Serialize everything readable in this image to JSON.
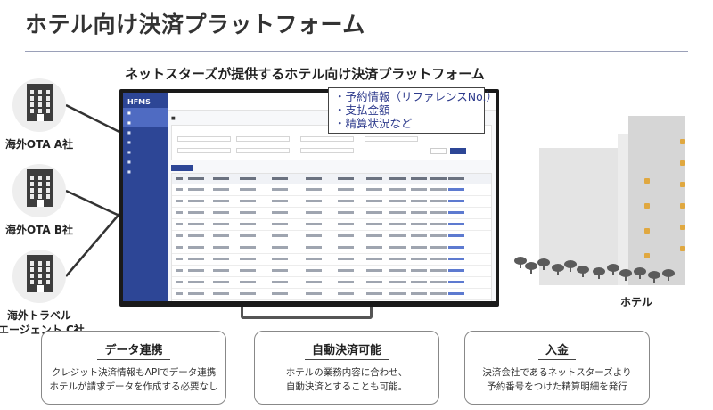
{
  "page_title": "ホテル向け決済プラットフォーム",
  "subtitle": "ネットスターズが提供するホテル向け決済プラットフォーム",
  "companies": [
    {
      "label_lines": [
        "海外OTA A社"
      ]
    },
    {
      "label_lines": [
        "海外OTA B社"
      ]
    },
    {
      "label_lines": [
        "海外トラベル",
        "エージェント C社"
      ]
    }
  ],
  "callout": {
    "items": [
      "・予約情報（リファレンスNo.）",
      "・支払金額",
      "・精算状況など"
    ]
  },
  "hotel_label": "ホテル",
  "features": [
    {
      "title": "データ連携",
      "lines": [
        "クレジット決済情報もAPIでデータ連携",
        "ホテルが請求データを作成する必要なし"
      ]
    },
    {
      "title": "自動決済可能",
      "lines": [
        "ホテルの業務内容に合わせ、",
        "自動決済とすることも可能。"
      ]
    },
    {
      "title": "入金",
      "lines": [
        "決済会社であるネットスターズより",
        "予約番号をつけた精算明細を発行"
      ]
    }
  ],
  "colors": {
    "sidebar": "#2d4696",
    "callout_text": "#2d3a8c",
    "window_light": "#e0a840"
  },
  "icons": {
    "company": "office-building-icon",
    "hotel": "hotel-buildings-illustration",
    "display": "monitor-icon"
  }
}
